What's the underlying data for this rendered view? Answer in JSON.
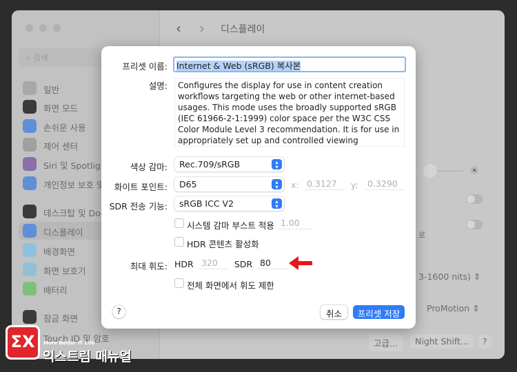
{
  "window": {
    "title": "디스플레이",
    "search_placeholder": "검색"
  },
  "sidebar": {
    "items": [
      {
        "label": "일반",
        "color": "#a8a8a8"
      },
      {
        "label": "화면 모드",
        "color": "#3a3a3a"
      },
      {
        "label": "손쉬운 사용",
        "color": "#5e8fd8"
      },
      {
        "label": "제어 센터",
        "color": "#a0a0a0"
      },
      {
        "label": "Siri 및 Spotlight",
        "color": "#8a6fa8"
      },
      {
        "label": "개인정보 보호 및 보안",
        "color": "#5e8fd8"
      },
      {
        "label": "데스크탑 및 Dock",
        "color": "#3a3a3a"
      },
      {
        "label": "디스플레이",
        "color": "#5e8fd8"
      },
      {
        "label": "배경화면",
        "color": "#8fc0e0"
      },
      {
        "label": "화면 보호기",
        "color": "#8fc0d8"
      },
      {
        "label": "배터리",
        "color": "#7cc07c"
      },
      {
        "label": "잠금 화면",
        "color": "#3a3a3a"
      },
      {
        "label": "Touch ID 및 암호",
        "color": "#e07070"
      }
    ]
  },
  "background": {
    "partial_label": "로",
    "preset_select": "3-1600 nits)",
    "refresh_select": "ProMotion",
    "advanced_button": "고급...",
    "night_shift_button": "Night Shift...",
    "help_button": "?"
  },
  "dialog": {
    "name_label": "프리셋 이름:",
    "name_value": "Internet & Web (sRGB) 복사본",
    "desc_label": "설명:",
    "desc_value": "Configures the display for use in content creation workflows targeting the web or other internet-based usages. This mode uses the broadly supported sRGB (IEC 61966-2-1:1999) color space per the W3C CSS Color Module Level 3 recommendation. It is for use in appropriately set up and controlled viewing",
    "gamut_label": "색상 감마:",
    "gamut_value": "Rec.709/sRGB",
    "white_label": "화이트 포인트:",
    "white_value": "D65",
    "x_label": "x:",
    "x_value": "0.3127",
    "y_label": "y:",
    "y_value": "0.3290",
    "sdr_label": "SDR 전송 기능:",
    "sdr_value": "sRGB ICC V2",
    "gamma_boost_label": "시스템 감마 부스트 적용",
    "gamma_boost_value": "1.00",
    "gamma_boost_checked": false,
    "hdr_enable_label": "HDR 콘텐츠 활성화",
    "hdr_enable_checked": false,
    "max_lum_label": "최대 휘도:",
    "hdr_label": "HDR",
    "hdr_value": "320",
    "sdr_lum_label": "SDR",
    "sdr_lum_value": "80",
    "limit_label": "전체 화면에서 휘도 제한",
    "limit_checked": false,
    "help": "?",
    "cancel": "취소",
    "save": "프리셋 저장"
  },
  "colors": {
    "accent": "#2f7cf6",
    "arrow": "#e8151b"
  },
  "watermark": {
    "tagline": "More Better IT Life",
    "name": "익스트림 매뉴얼"
  }
}
